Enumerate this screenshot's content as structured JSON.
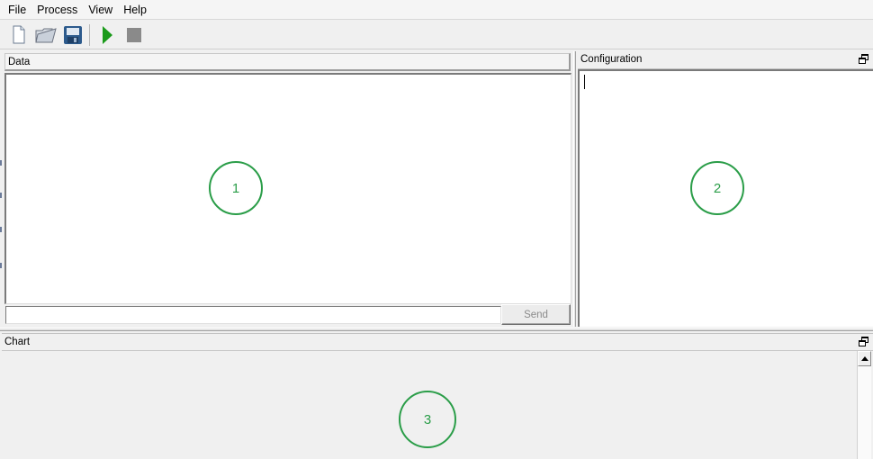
{
  "menu": {
    "items": [
      "File",
      "Process",
      "View",
      "Help"
    ]
  },
  "toolbar": {
    "buttons": [
      "new-file-icon",
      "open-folder-icon",
      "save-disk-icon",
      "run-play-icon",
      "stop-icon"
    ],
    "colors": {
      "play": "#1a9a1a",
      "stop": "#8a8a8a",
      "save": "#2c5a8c"
    }
  },
  "panels": {
    "data_title": "Data",
    "configuration_title": "Configuration",
    "chart_title": "Chart"
  },
  "send": {
    "input_value": "",
    "button_label": "Send"
  },
  "markers": [
    "1",
    "2",
    "3"
  ],
  "accent": "#2a9d48"
}
